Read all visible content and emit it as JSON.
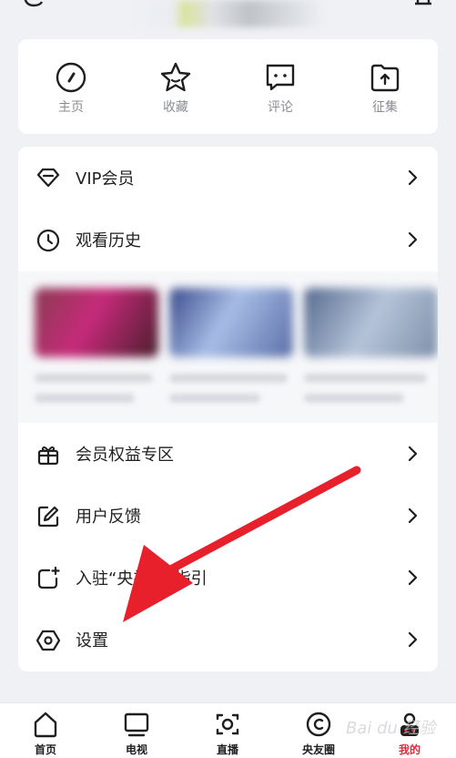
{
  "quick_actions": [
    {
      "label": "主页",
      "icon": "compass-icon"
    },
    {
      "label": "收藏",
      "icon": "star-icon"
    },
    {
      "label": "评论",
      "icon": "comment-icon"
    },
    {
      "label": "征集",
      "icon": "upload-folder-icon"
    }
  ],
  "menu": {
    "vip": "VIP会员",
    "history": "观看历史",
    "benefits": "会员权益专区",
    "feedback": "用户反馈",
    "join": "入驻“央视频”指引",
    "settings": "设置"
  },
  "tabs": [
    {
      "label": "首页",
      "icon": "home-icon"
    },
    {
      "label": "电视",
      "icon": "tv-icon"
    },
    {
      "label": "直播",
      "icon": "live-icon"
    },
    {
      "label": "央友圈",
      "icon": "circle-icon"
    },
    {
      "label": "我的",
      "icon": "profile-icon",
      "active": true
    }
  ],
  "accent_color": "#e02a3a",
  "watermark": "Bai du 经验"
}
